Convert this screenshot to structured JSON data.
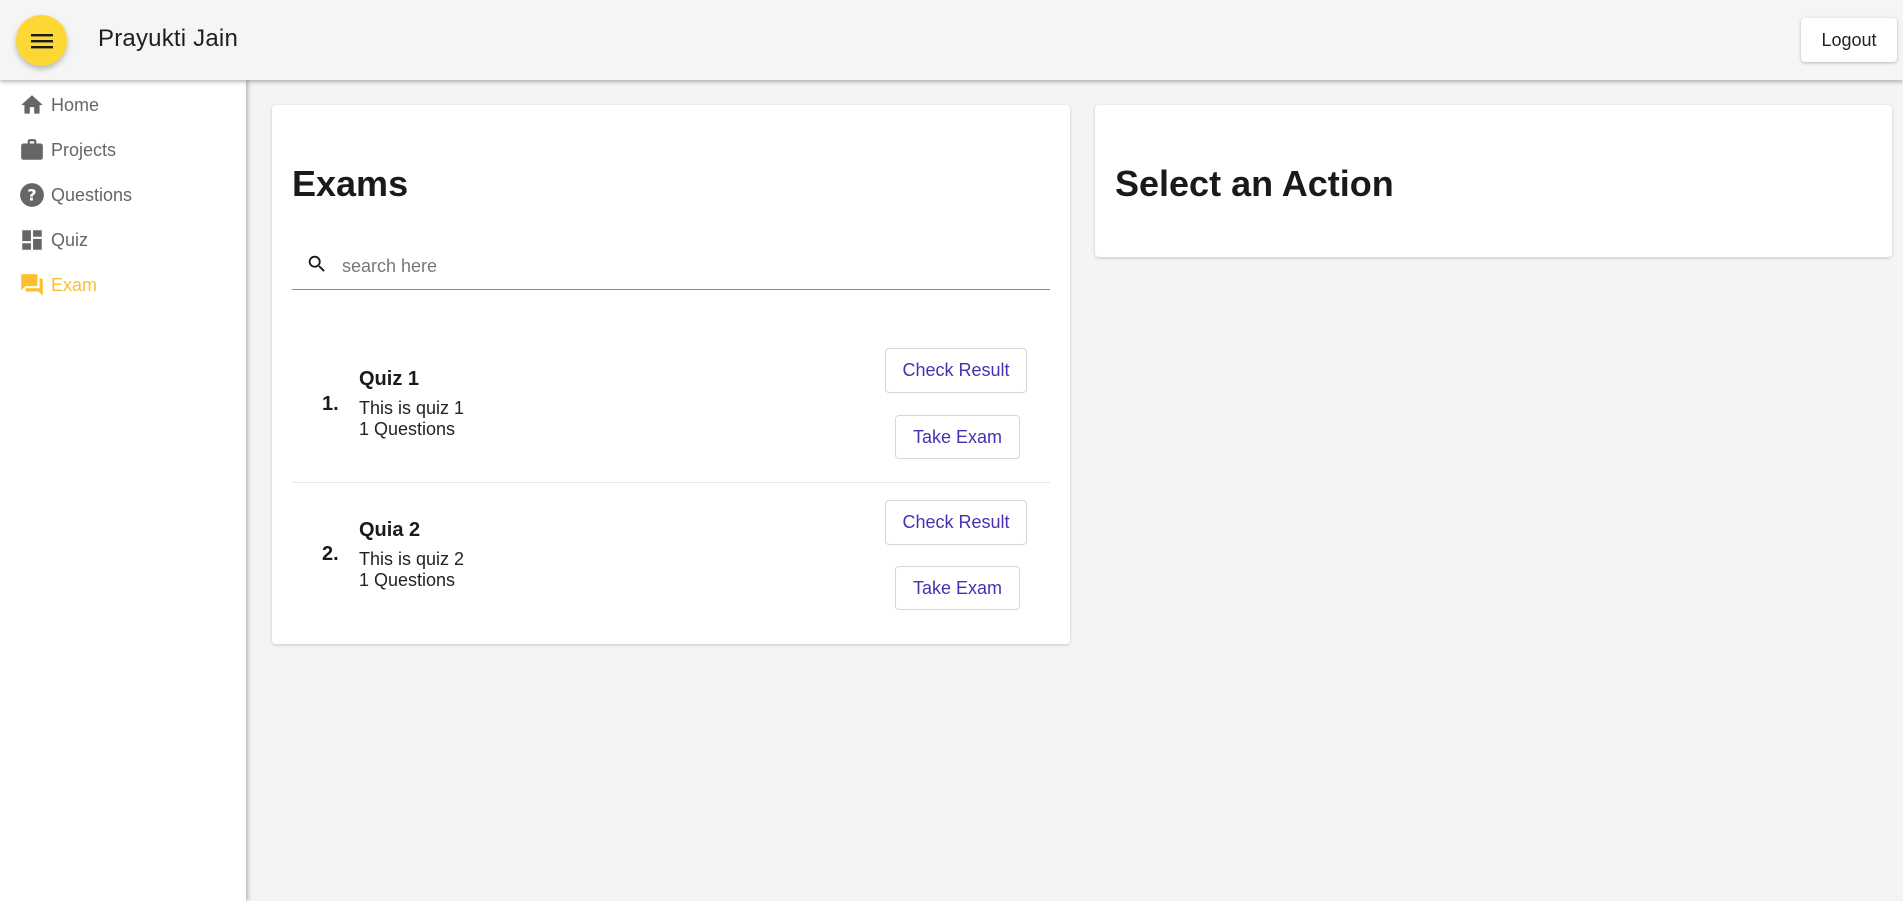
{
  "header": {
    "menu_icon": "hamburger-menu-icon",
    "user_name": "Prayukti Jain",
    "logout_label": "Logout",
    "accent_color": "#fdd835"
  },
  "sidebar": {
    "items": [
      {
        "label": "Home",
        "icon": "home-icon",
        "active": false
      },
      {
        "label": "Projects",
        "icon": "briefcase-icon",
        "active": false
      },
      {
        "label": "Questions",
        "icon": "help-circle-icon",
        "active": false
      },
      {
        "label": "Quiz",
        "icon": "dashboard-icon",
        "active": false
      },
      {
        "label": "Exam",
        "icon": "forum-icon",
        "active": true
      }
    ],
    "active_color": "#fbc02d"
  },
  "exams": {
    "title": "Exams",
    "search": {
      "placeholder": "search here",
      "value": ""
    },
    "quizzes": [
      {
        "number": "1.",
        "title": "Quiz 1",
        "description": "This is quiz 1",
        "questions": "1 Questions",
        "check_label": "Check Result",
        "take_label": "Take Exam"
      },
      {
        "number": "2.",
        "title": "Quia 2",
        "description": "This is quiz 2",
        "questions": "1 Questions",
        "check_label": "Check Result",
        "take_label": "Take Exam"
      }
    ],
    "button_color": "#4a2fb0"
  },
  "action_panel": {
    "title": "Select an Action"
  }
}
